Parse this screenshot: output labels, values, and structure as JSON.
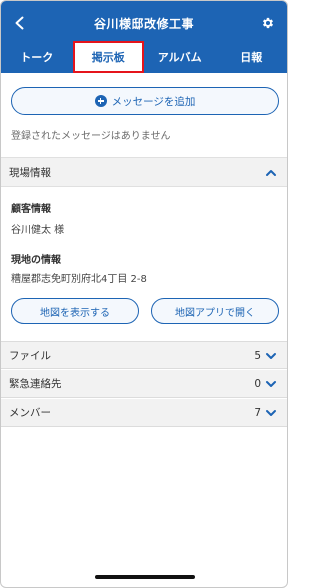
{
  "header": {
    "title": "谷川様邸改修工事",
    "back_icon": "chevron-left-icon",
    "settings_icon": "gear-icon",
    "color": "#1d64b4"
  },
  "tabs": [
    {
      "label": "トーク"
    },
    {
      "label": "掲示板",
      "active": true
    },
    {
      "label": "アルバム"
    },
    {
      "label": "日報"
    }
  ],
  "board": {
    "add_label": "メッセージを追加",
    "empty_text": "登録されたメッセージはありません"
  },
  "site_info": {
    "title": "現場情報",
    "customer_label": "顧客情報",
    "customer_name": "谷川健太 様",
    "location_label": "現地の情報",
    "address": "糟屋郡志免町別府北4丁目 2-8",
    "show_map": "地図を表示する",
    "open_map_app": "地図アプリで開く"
  },
  "collapsibles": [
    {
      "label": "ファイル",
      "count": "5"
    },
    {
      "label": "緊急連絡先",
      "count": "0"
    },
    {
      "label": "メンバー",
      "count": "7"
    }
  ]
}
